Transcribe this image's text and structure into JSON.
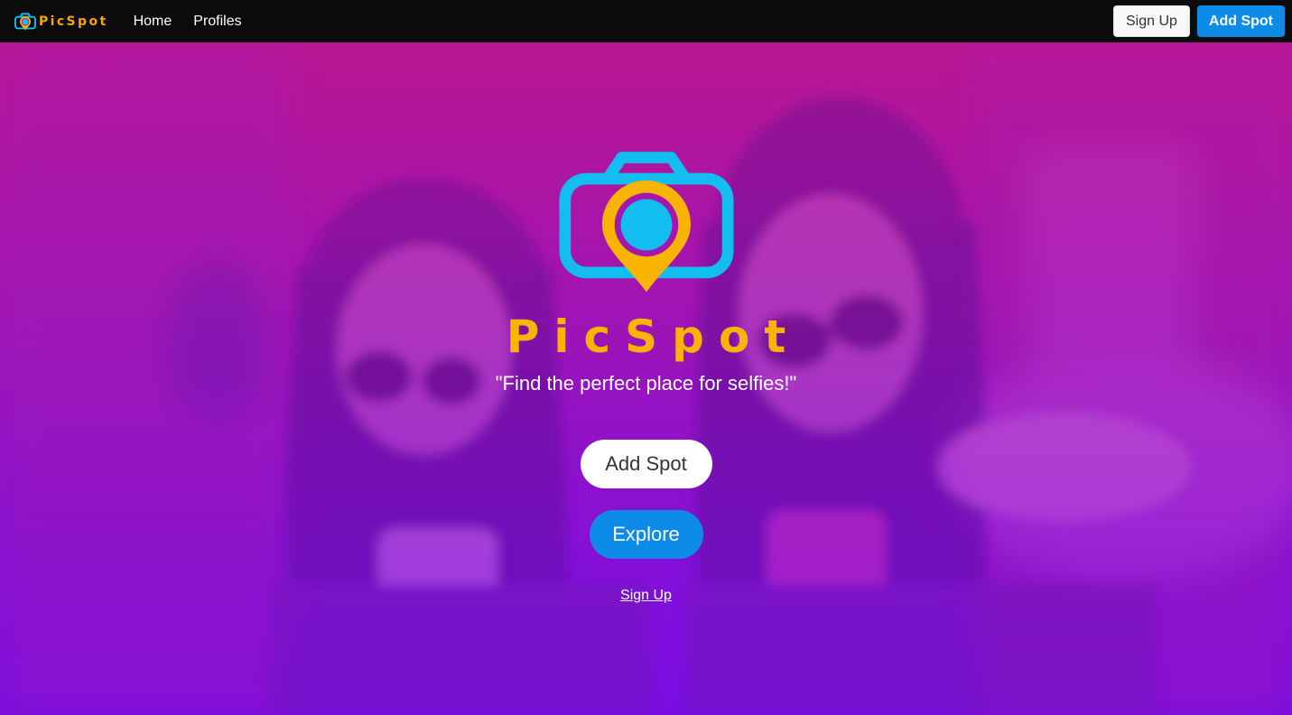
{
  "navbar": {
    "brand_name": "PicSpot",
    "links": [
      {
        "label": "Home"
      },
      {
        "label": "Profiles"
      }
    ],
    "signup_label": "Sign Up",
    "add_spot_label": "Add Spot"
  },
  "hero": {
    "logo_icon": "camera-location-pin-icon",
    "title": "PicSpot",
    "tagline": "\"Find the perfect place for selfies!\"",
    "add_spot_label": "Add Spot",
    "explore_label": "Explore",
    "signup_link_label": "Sign Up"
  },
  "colors": {
    "accent_blue": "#0d8be8",
    "brand_orange": "#f8b400",
    "logo_cyan": "#12bdf0",
    "hero_purple": "#7a10dc",
    "hero_magenta": "#b2198f",
    "navbar_bg": "#0b0b0b"
  }
}
